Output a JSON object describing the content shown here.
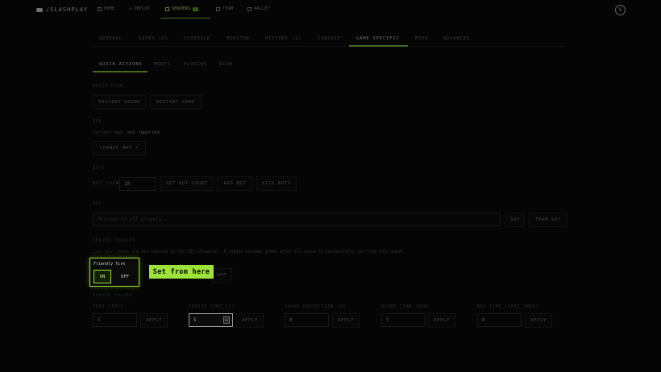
{
  "nav": {
    "logo": "/SLASHPLAY",
    "items": [
      {
        "label": "HOME",
        "icon": "home-icon"
      },
      {
        "label": "DEPLOY",
        "icon": "plus-icon"
      },
      {
        "label": "SERVERS",
        "icon": "server-icon",
        "badge": "1"
      },
      {
        "label": "TEAM",
        "icon": "team-icon"
      },
      {
        "label": "WALLET",
        "icon": "wallet-icon"
      }
    ],
    "avatar_initial": "S"
  },
  "tabs": [
    "GENERAL",
    "SAVES (0)",
    "SCHEDULE",
    "MONITOR",
    "HISTORY (1)",
    "CONSOLE",
    "GAME-SPECIFIC",
    "MODS",
    "ADVANCED"
  ],
  "active_tab": "GAME-SPECIFIC",
  "subtabs": [
    "QUICK ACTIONS",
    "MODES",
    "PLUGINS",
    "RCON"
  ],
  "active_subtab": "QUICK ACTIONS",
  "sections": {
    "match_flow": {
      "label": "MATCH FLOW",
      "restart_round": "RESTART ROUND",
      "restart_game": "RESTART GAME"
    },
    "map": {
      "label": "MAP",
      "current_prefix": "Current map:",
      "current_value": "not reported",
      "change_map": "CHANGE MAP ▾"
    },
    "bots": {
      "label": "BOTS",
      "bot_count_label": "BOT COUNT",
      "bot_count_value": "10",
      "set_bot_count": "SET BOT COUNT",
      "add_bot": "ADD BOT",
      "kick_bots": "KICK BOTS"
    },
    "say": {
      "label": "SAY",
      "placeholder": "Message to all players...",
      "say_button": "SAY",
      "team_say_button": "TEAM SAY"
    },
    "toggles": {
      "label": "SERVER TOGGLES",
      "note": "Live your reads are not exposed by the CS2 allowlist. A toggle becomes green after its value is successfully set from this panel.",
      "friendly_fire_label": "Friendly fire",
      "on": "ON",
      "off": "OFF",
      "second_off": "OFF"
    },
    "values": {
      "label": "SERVER VALUES",
      "apply": "APPLY",
      "fields": [
        {
          "label": "TEAM LIMIT",
          "value": "5"
        },
        {
          "label": "FREEZE TIME (S)",
          "value": "5"
        },
        {
          "label": "SPAWN PROTECTION (S)",
          "value": "0"
        },
        {
          "label": "ROUND TIME (MIN)",
          "value": "5"
        },
        {
          "label": "MAP TIME LIMIT (MIN)",
          "value": "0"
        }
      ]
    }
  },
  "tooltip": "Set from here",
  "colors": {
    "accent": "#9ee23c",
    "background": "#0a0a0a"
  }
}
